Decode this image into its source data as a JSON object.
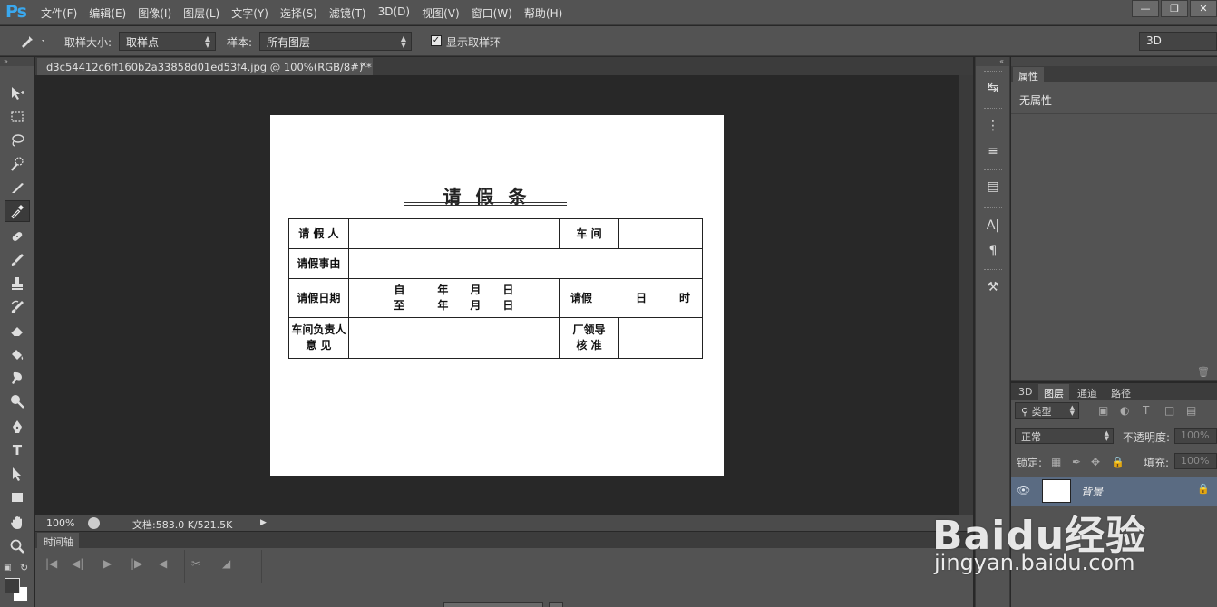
{
  "app": {
    "logo": "Ps",
    "menus": [
      "文件(F)",
      "编辑(E)",
      "图像(I)",
      "图层(L)",
      "文字(Y)",
      "选择(S)",
      "滤镜(T)",
      "3D(D)",
      "视图(V)",
      "窗口(W)",
      "帮助(H)"
    ]
  },
  "options": {
    "sample_size_label": "取样大小:",
    "sample_size_value": "取样点",
    "sample_label": "样本:",
    "sample_value": "所有图层",
    "show_ring_label": "显示取样环",
    "workspace": "3D"
  },
  "document": {
    "tab_title": "d3c54412c6ff160b2a33858d01ed53f4.jpg @ 100%(RGB/8#) *",
    "zoom": "100%",
    "doc_size": "文档:583.0 K/521.5K"
  },
  "paper": {
    "title": "请假条",
    "rows": [
      [
        "请 假 人",
        "",
        "车 间",
        ""
      ],
      [
        "请假事由",
        ""
      ],
      [
        "请假日期",
        "自　　　年　　月　　日",
        "至　　　年　　月　　日",
        "请假　　　　日　　　时"
      ],
      [
        "车间负责人",
        "意 见",
        "",
        "厂领导",
        "核 准",
        ""
      ]
    ]
  },
  "timeline": {
    "tab": "时间轴"
  },
  "properties": {
    "tab": "属性",
    "empty_label": "无属性"
  },
  "layers_panel": {
    "tabs": [
      "3D",
      "图层",
      "通道",
      "路径"
    ],
    "filter_value": "类型",
    "blend_mode": "正常",
    "opacity_label": "不透明度:",
    "opacity_value": "100%",
    "lock_label": "锁定:",
    "fill_label": "填充:",
    "fill_value": "100%",
    "layer_name": "背景"
  },
  "watermark": {
    "main": "Baidu经验",
    "sub": "jingyan.baidu.com"
  },
  "colors": {
    "accent": "#3aa8ee",
    "panel": "#535353",
    "canvas_bg": "#282828",
    "selected_layer": "#5a6b82"
  }
}
